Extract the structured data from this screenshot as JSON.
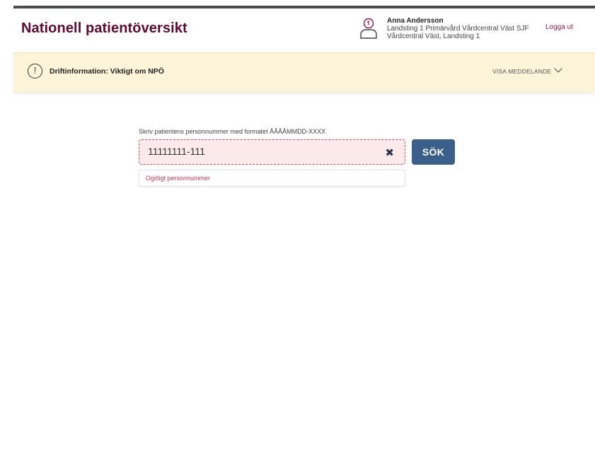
{
  "header": {
    "title": "Nationell patientöversikt",
    "user": {
      "name": "Anna Andersson",
      "line1": "Landsting 1 Primärvård Vårdcentral Väst SJF",
      "line2": "Vårdcentral Väst, Landsting 1"
    },
    "logout_label": "Logga ut",
    "user_icon": "user-profile-icon",
    "colors": {
      "title": "#5c0a34",
      "rule": "#4d4d4d"
    }
  },
  "banner": {
    "icon": "exclamation-circle-icon",
    "icon_glyph": "!",
    "text": "Driftinformation: Viktigt om NPÖ",
    "toggle_label": "VISA MEDDELANDE",
    "toggle_icon": "chevron-down-icon",
    "background": "#fbf4d8"
  },
  "search": {
    "label": "Skriv patientens personnummer med formatet ÅÅÅÅMMDD-XXXX",
    "value": "11111111-111",
    "clear_icon": "close-icon",
    "clear_glyph": "✖",
    "button_label": "SÖK",
    "error": "Ogiltigt personnummer",
    "colors": {
      "button": "#3a5f8a",
      "error": "#c23a57",
      "field_bg": "#fbe9ec"
    }
  }
}
